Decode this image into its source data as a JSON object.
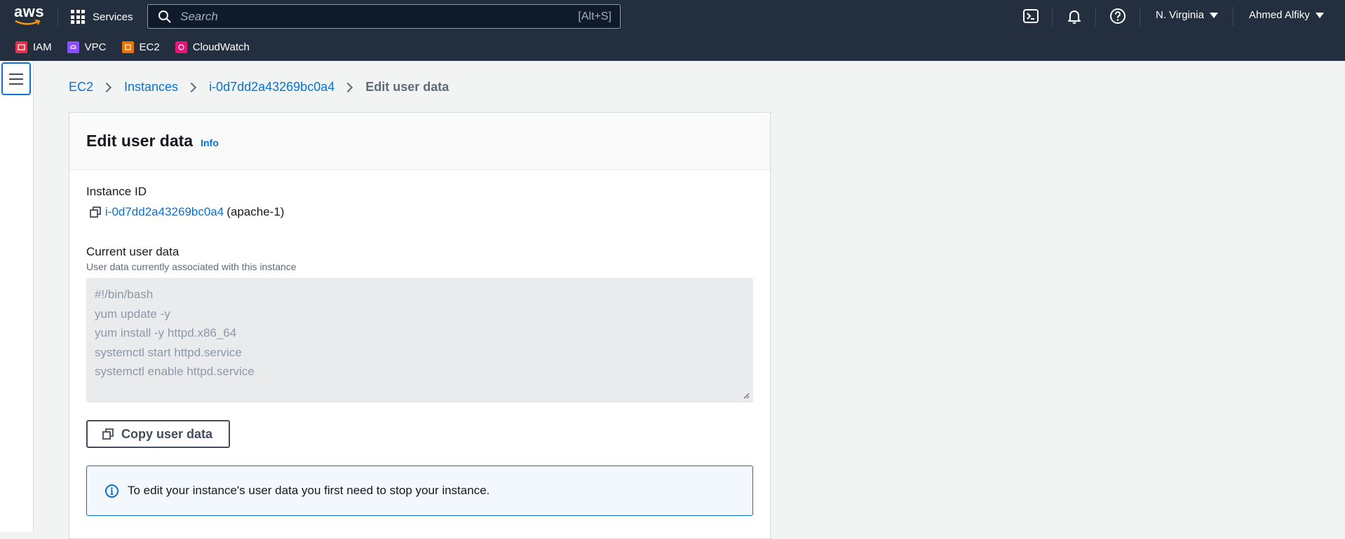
{
  "topnav": {
    "logo_text": "aws",
    "services_label": "Services",
    "search_placeholder": "Search",
    "search_shortcut": "[Alt+S]",
    "region": "N. Virginia",
    "user": "Ahmed Alfiky",
    "icons": [
      "cloudshell-icon",
      "bell-icon",
      "help-icon"
    ]
  },
  "favorites": [
    {
      "label": "IAM",
      "color": "#dd344c"
    },
    {
      "label": "VPC",
      "color": "#8c4fff"
    },
    {
      "label": "EC2",
      "color": "#ed7100"
    },
    {
      "label": "CloudWatch",
      "color": "#e7157b"
    }
  ],
  "breadcrumb": {
    "items": [
      "EC2",
      "Instances",
      "i-0d7dd2a43269bc0a4"
    ],
    "current": "Edit user data"
  },
  "panel": {
    "title": "Edit user data",
    "info": "Info",
    "instance_label": "Instance ID",
    "instance_id": "i-0d7dd2a43269bc0a4",
    "instance_name": "(apache-1)",
    "current_label": "Current user data",
    "current_desc": "User data currently associated with this instance",
    "user_data_lines": [
      "#!/bin/bash",
      "yum update -y",
      "yum install -y httpd.x86_64",
      "systemctl start httpd.service",
      "systemctl enable httpd.service"
    ],
    "copy_button": "Copy user data",
    "alert_text": "To edit your instance's user data you first need to stop your instance."
  },
  "colors": {
    "nav_bg": "#232f3e",
    "link": "#0972d3",
    "alert_bg": "#f2f8fd"
  }
}
